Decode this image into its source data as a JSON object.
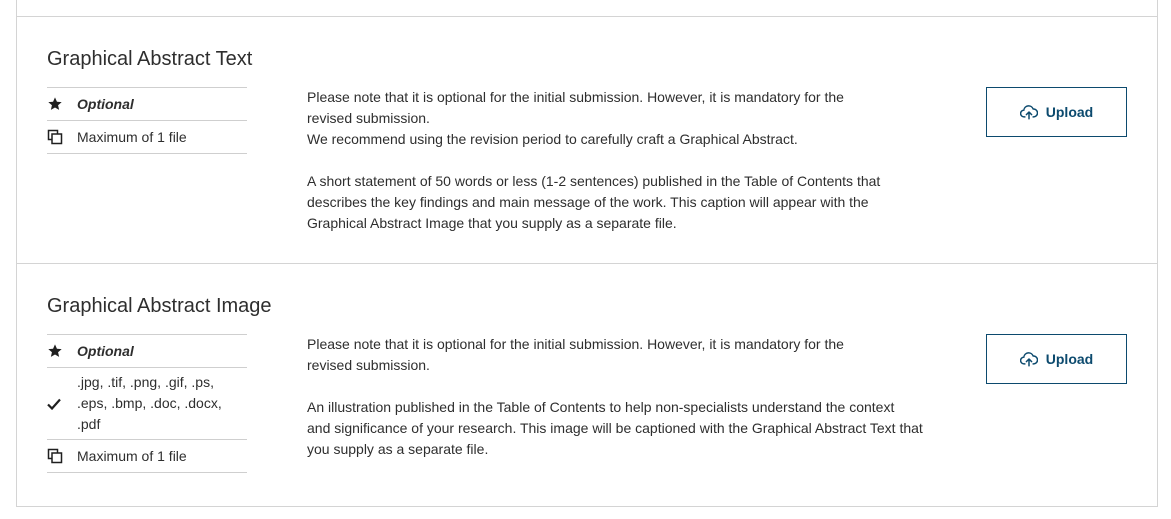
{
  "sections": [
    {
      "title": "Graphical Abstract Text",
      "meta": {
        "optional_label": "Optional",
        "max_files_label": "Maximum of 1 file"
      },
      "description": {
        "line1": "Please note that it is optional for the initial submission. However, it is mandatory for the",
        "line2": "revised submission.",
        "line3": "We recommend using the revision period to carefully craft a Graphical Abstract.",
        "line4": "A short statement of 50 words or less (1-2 sentences) published in the Table of Contents that",
        "line5": "describes the key findings and main message of the work. This caption will appear with the",
        "line6": "Graphical Abstract Image that you supply as a separate file."
      },
      "upload_label": "Upload"
    },
    {
      "title": "Graphical Abstract Image",
      "meta": {
        "optional_label": "Optional",
        "formats_line1": ".jpg, .tif, .png, .gif, .ps,",
        "formats_line2": ".eps, .bmp, .doc, .docx,",
        "formats_line3": ".pdf",
        "max_files_label": "Maximum of 1 file"
      },
      "description": {
        "line1": "Please note that it is optional for the initial submission. However, it is mandatory for the",
        "line2": "revised submission.",
        "line3": "An illustration published in the Table of Contents to help non-specialists understand the context",
        "line4": "and significance of your research. This image will be captioned with the Graphical Abstract Text that",
        "line5": "you supply as a separate file."
      },
      "upload_label": "Upload"
    }
  ],
  "icons": {
    "optional": "star-icon",
    "max_files": "copy-icon",
    "formats": "check-icon",
    "upload": "cloud-upload-icon"
  },
  "colors": {
    "accent": "#0c4a6e",
    "border": "#d4d4d4",
    "text": "#2e2e2e"
  }
}
